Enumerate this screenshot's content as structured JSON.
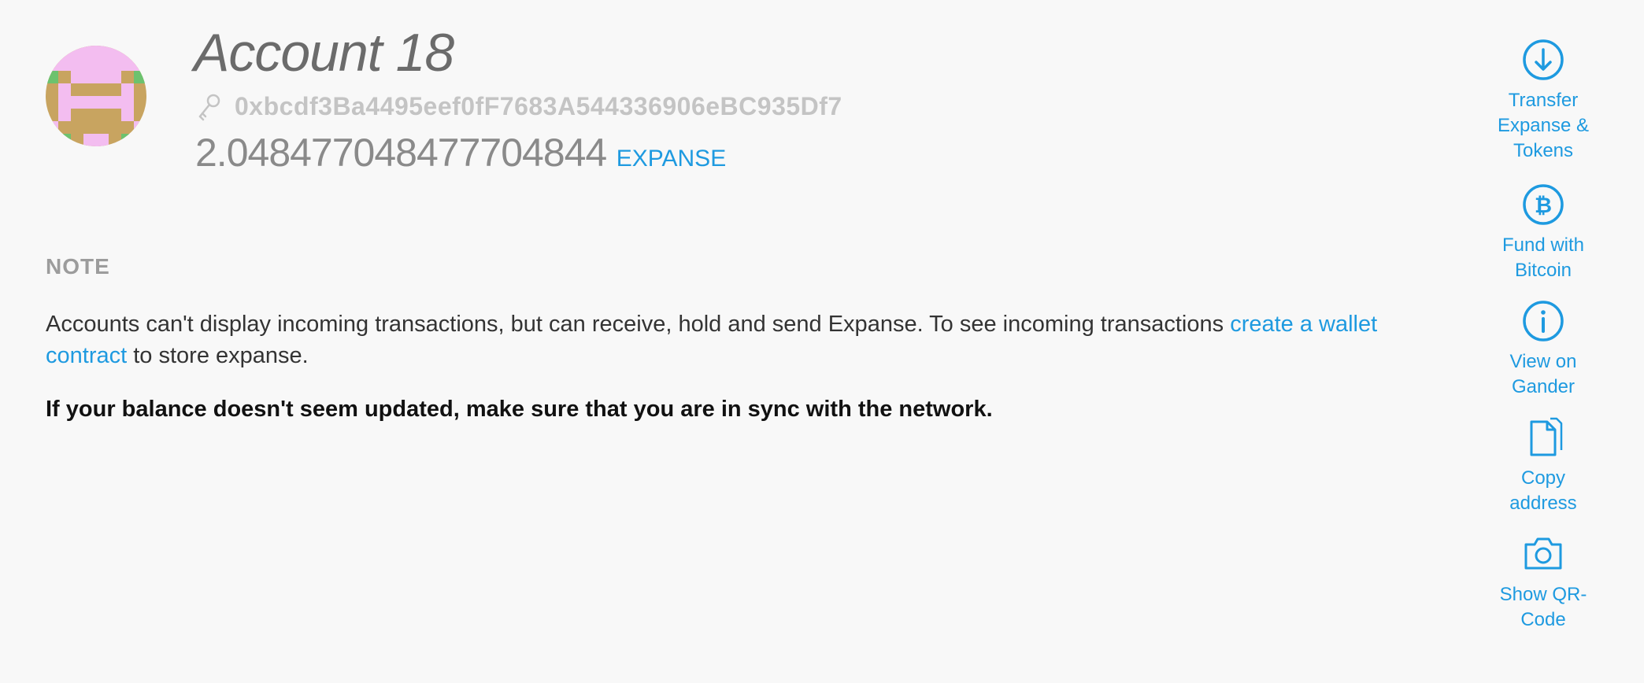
{
  "account": {
    "name": "Account 18",
    "address": "0xbcdf3Ba4495eef0fF7683A544336906eBC935Df7",
    "balance": "2.048477048477704844",
    "unit": "EXPANSE"
  },
  "note": {
    "label": "NOTE",
    "text_before": "Accounts can't display incoming transactions, but can receive, hold and send Expanse. To see incoming transactions ",
    "link": "create a wallet contract",
    "text_after": " to store expanse.",
    "sync": "If your balance doesn't seem updated, make sure that you are in sync with the network."
  },
  "actions": [
    {
      "label": "Transfer\nExpanse &\nTokens",
      "icon": "arrow-down-circle-icon"
    },
    {
      "label": "Fund with\nBitcoin",
      "icon": "bitcoin-icon"
    },
    {
      "label": "View on\nGander",
      "icon": "info-icon"
    },
    {
      "label": "Copy\naddress",
      "icon": "copy-icon"
    },
    {
      "label": "Show QR-\nCode",
      "icon": "camera-icon"
    }
  ],
  "colors": {
    "accent": "#1e9ae0",
    "background": "#f8f8f8",
    "identicon_pink": "#f3bdf0",
    "identicon_tan": "#c8a460",
    "identicon_green": "#6cc26e"
  }
}
